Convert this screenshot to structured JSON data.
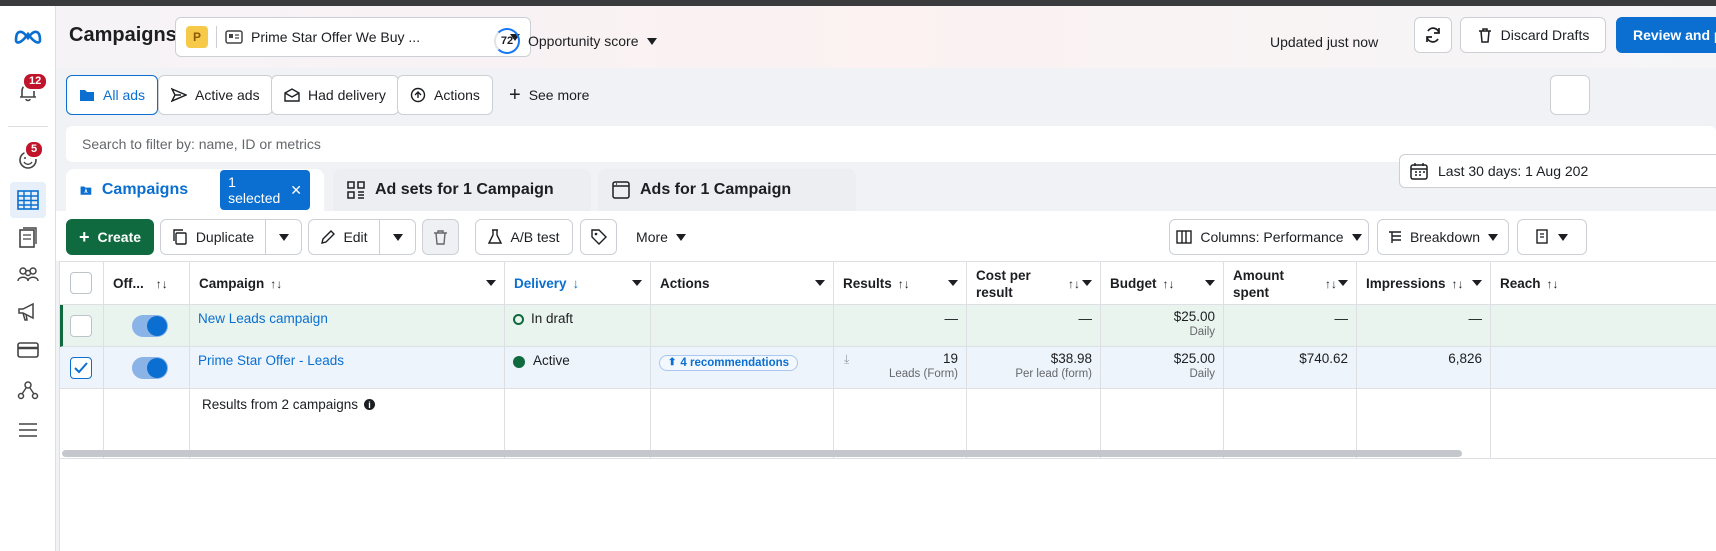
{
  "header": {
    "title": "Campaigns",
    "account_initial": "P",
    "account_name": "Prime Star Offer We Buy ...",
    "opportunity_score_value": "72",
    "opportunity_score_label": "Opportunity score",
    "updated_text": "Updated just now",
    "discard_label": "Discard Drafts",
    "review_label": "Review and pub"
  },
  "rail": {
    "notifications_badge": "12",
    "activity_badge": "5",
    "icons": [
      "meta-logo-icon",
      "bell-icon",
      "face-icon",
      "table-icon",
      "pages-icon",
      "people-icon",
      "megaphone-icon",
      "card-icon",
      "network-icon",
      "menu-icon"
    ]
  },
  "filters": {
    "all_ads": "All ads",
    "active_ads": "Active ads",
    "had_delivery": "Had delivery",
    "actions": "Actions",
    "see_more": "See more"
  },
  "search": {
    "placeholder": "Search to filter by: name, ID or metrics"
  },
  "tabs": {
    "campaigns": "Campaigns",
    "selected_chip": "1 selected",
    "adsets": "Ad sets for 1 Campaign",
    "ads": "Ads for 1 Campaign"
  },
  "date_range": "Last 30 days: 1 Aug 202",
  "toolbar": {
    "create": "Create",
    "duplicate": "Duplicate",
    "edit": "Edit",
    "ab_test": "A/B test",
    "more": "More",
    "columns": "Columns: Performance",
    "breakdown": "Breakdown"
  },
  "table": {
    "headers": {
      "onoff": "Off...",
      "campaign": "Campaign",
      "delivery": "Delivery",
      "actions": "Actions",
      "results": "Results",
      "cost_per_result": "Cost per result",
      "budget": "Budget",
      "amount_spent": "Amount spent",
      "impressions": "Impressions",
      "reach": "Reach"
    },
    "rows": [
      {
        "checked": false,
        "on": true,
        "campaign": "New Leads campaign",
        "delivery": "In draft",
        "actions": "",
        "results": "—",
        "results_sub": "",
        "cost": "—",
        "cost_sub": "",
        "budget": "$25.00",
        "budget_sub": "Daily",
        "spent": "—",
        "impressions": "—"
      },
      {
        "checked": true,
        "on": true,
        "campaign": "Prime Star Offer - Leads",
        "delivery": "Active",
        "actions": "4 recommendations",
        "results": "19",
        "results_sub": "Leads (Form)",
        "cost": "$38.98",
        "cost_sub": "Per lead (form)",
        "budget": "$25.00",
        "budget_sub": "Daily",
        "spent": "$740.62",
        "impressions": "6,826"
      }
    ],
    "summary": "Results from 2 campaigns"
  },
  "colors": {
    "accent": "#0a6fd0",
    "create_green": "#0f6b3f",
    "badge_red": "#c0142b",
    "draft_row": "#eaf4ef",
    "selected_row": "#edf4fc"
  }
}
